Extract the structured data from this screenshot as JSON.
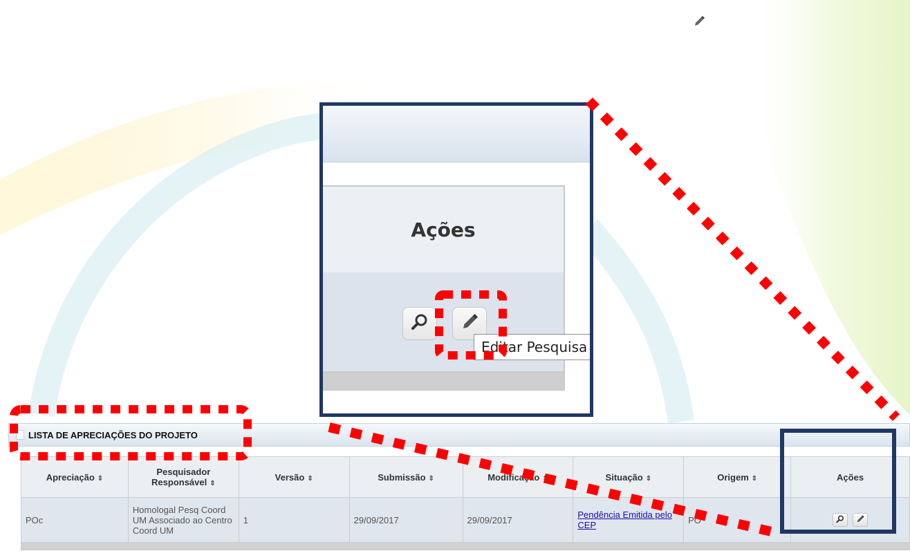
{
  "colors": {
    "annotation_red": "#ff0000",
    "annotation_navy": "#1f3864",
    "link": "#1a0dab"
  },
  "top_pencil": {
    "icon": "pencil-icon"
  },
  "zoom": {
    "header_label": "Ações",
    "tooltip": "Editar Pesquisa",
    "buttons": [
      "magnifier-icon",
      "pencil-icon"
    ]
  },
  "panel": {
    "title": "LISTA DE APRECIAÇÕES DO PROJETO",
    "table": {
      "headers": [
        {
          "label": "Apreciação",
          "sortable": true
        },
        {
          "label": "Pesquisador Responsável",
          "sortable": true
        },
        {
          "label": "Versão",
          "sortable": true
        },
        {
          "label": "Submissão",
          "sortable": true
        },
        {
          "label": "Modificação",
          "sortable": true
        },
        {
          "label": "Situação",
          "sortable": true
        },
        {
          "label": "Origem",
          "sortable": true
        },
        {
          "label": "Ações",
          "sortable": false
        }
      ],
      "sort_glyph": "⇕",
      "rows": [
        {
          "apreciacao": "POc",
          "pesquisador": "Homologal Pesq Coord UM Associado ao Centro Coord UM",
          "versao": "1",
          "submissao": "29/09/2017",
          "modificacao": "29/09/2017",
          "situacao": "Pendência Emitida pelo CEP",
          "origem": "PO",
          "acoes": [
            "magnifier-icon",
            "pencil-icon"
          ]
        }
      ]
    }
  }
}
